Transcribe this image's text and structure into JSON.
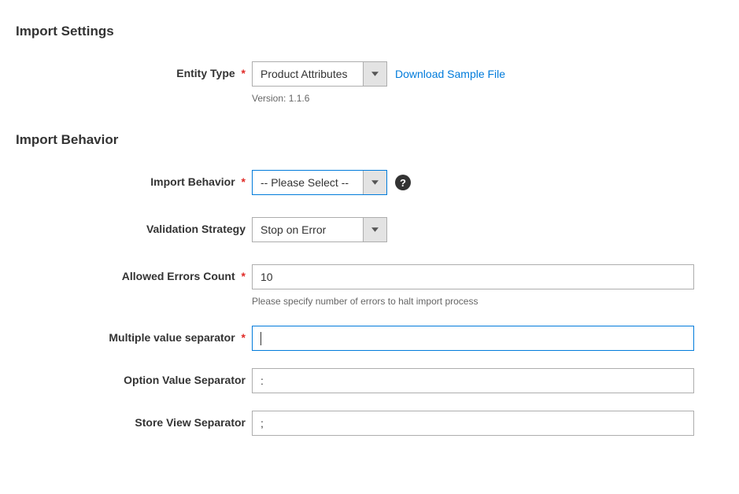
{
  "import_settings": {
    "title": "Import Settings",
    "entity_type": {
      "label": "Entity Type",
      "required": "*",
      "value": "Product Attributes",
      "version_note": "Version: 1.1.6",
      "download_link": "Download Sample File"
    }
  },
  "import_behavior": {
    "title": "Import Behavior",
    "behavior": {
      "label": "Import Behavior",
      "required": "*",
      "value": "-- Please Select --"
    },
    "validation_strategy": {
      "label": "Validation Strategy",
      "value": "Stop on Error"
    },
    "allowed_errors": {
      "label": "Allowed Errors Count",
      "required": "*",
      "value": "10",
      "hint": "Please specify number of errors to halt import process"
    },
    "multiple_value_sep": {
      "label": "Multiple value separator",
      "required": "*",
      "value": ""
    },
    "option_value_sep": {
      "label": "Option Value Separator",
      "value": ":"
    },
    "store_view_sep": {
      "label": "Store View Separator",
      "value": ";"
    }
  }
}
